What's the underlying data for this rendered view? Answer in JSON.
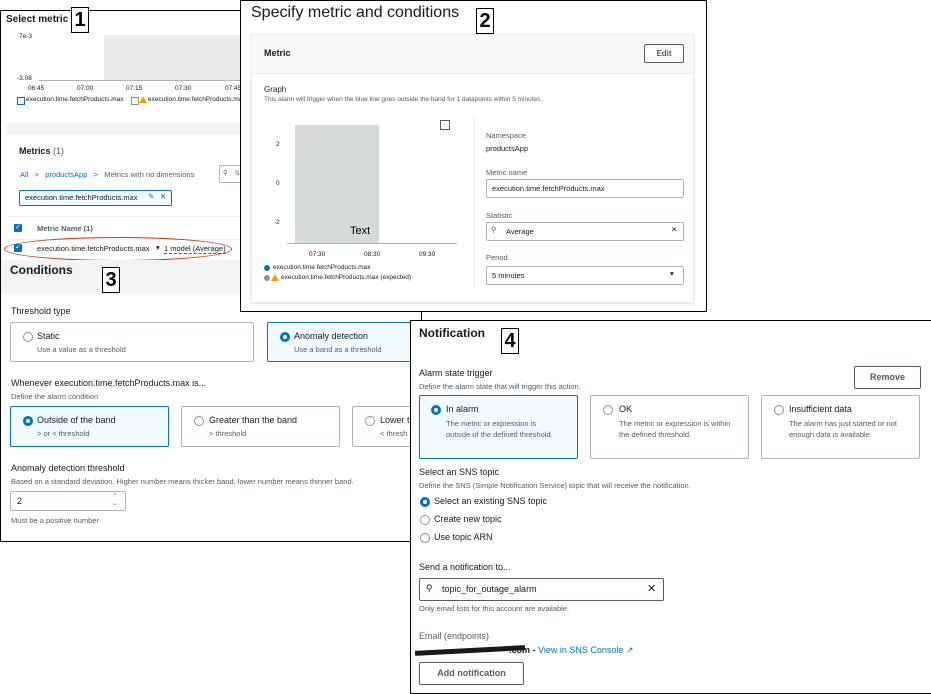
{
  "tags": {
    "p1": "1",
    "p2": "2",
    "p3": "3",
    "p4": "4"
  },
  "select_metric": {
    "title": "Select metric",
    "chart": {
      "y_top": "7e-3",
      "y_bottom": "-3.08",
      "x_ticks": [
        "06:45",
        "07:00",
        "07:15",
        "07:30",
        "07:45"
      ],
      "legend1": "execution.time.fetchProducts.max",
      "legend2": "execution.time.fetchProducts.max"
    },
    "metrics_title": "Metrics",
    "metrics_count": "(1)",
    "breadcrumb": {
      "all": "All",
      "app": "productsApp",
      "dims": "Metrics with no dimensions",
      "search_hint": "S"
    },
    "token": "execution.time.fetchProducts.max",
    "col_header": "Metric Name (1)",
    "row_name": "execution.time.fetchProducts.max",
    "row_model": "1 model (Average)"
  },
  "specify": {
    "title": "Specify metric and conditions",
    "metric_section": "Metric",
    "edit": "Edit",
    "graph_label": "Graph",
    "graph_desc": "This alarm will trigger when the blue line goes outside the band for 1 datapoints within 5 minutes.",
    "chart": {
      "y_ticks": [
        "2",
        "0",
        "-2"
      ],
      "x_ticks": [
        "07:30",
        "08:30",
        "09:30"
      ],
      "overlay": "Text",
      "legend1": "execution.time.fetchProducts.max",
      "legend2": "execution.time.fetchProducts.max (expected)"
    },
    "namespace_label": "Namespace",
    "namespace_value": "productsApp",
    "metric_name_label": "Metric name",
    "metric_name_value": "execution.time.fetchProducts.max",
    "statistic_label": "Statistic",
    "statistic_value": "Average",
    "period_label": "Period",
    "period_value": "5 minutes"
  },
  "conditions": {
    "title": "Conditions",
    "threshold_type": "Threshold type",
    "static": "Static",
    "static_desc": "Use a value as a threshold",
    "anomaly": "Anomaly detection",
    "anomaly_desc": "Use a band as a threshold",
    "whenever": "Whenever execution.time.fetchProducts.max is...",
    "whenever_desc": "Define the alarm condition",
    "outside": "Outside of the band",
    "outside_desc": "> or < threshold",
    "greater": "Greater than the band",
    "greater_desc": "> threshold",
    "lower": "Lower t",
    "lower_desc": "< thresh",
    "adt_label": "Anomaly detection threshold",
    "adt_desc": "Based on a standard deviation. Higher number means thicker band, lower number means thinner band.",
    "adt_value": "2",
    "adt_hint": "Must be a positive number"
  },
  "notification": {
    "title": "Notification",
    "trigger_label": "Alarm state trigger",
    "trigger_desc": "Define the alarm state that will trigger this action.",
    "remove": "Remove",
    "in_alarm": "In alarm",
    "in_alarm_desc": "The metric or expression is outside of the defined threshold.",
    "ok": "OK",
    "ok_desc": "The metric or expression is within the defined threshold.",
    "insufficient": "Insufficient data",
    "insufficient_desc": "The alarm has just started or not enough data is available.",
    "sns_label": "Select an SNS topic",
    "sns_desc": "Define the SNS (Simple Notification Service) topic that will receive the notification.",
    "opt_existing": "Select an existing SNS topic",
    "opt_new": "Create new topic",
    "opt_arn": "Use topic ARN",
    "send_label": "Send a notification to...",
    "topic_value": "topic_for_outage_alarm",
    "topic_hint": "Only email lists for this account are available.",
    "email_label": "Email (endpoints)",
    "email_value": ".com",
    "view_sns": "View in SNS Console",
    "add": "Add notification"
  },
  "colors": {
    "accent": "#0073bb",
    "selected_bg": "#f1faff",
    "band_gray": "#d5dbdb",
    "warning": "#ff9900",
    "annotation_red": "#d13212"
  }
}
